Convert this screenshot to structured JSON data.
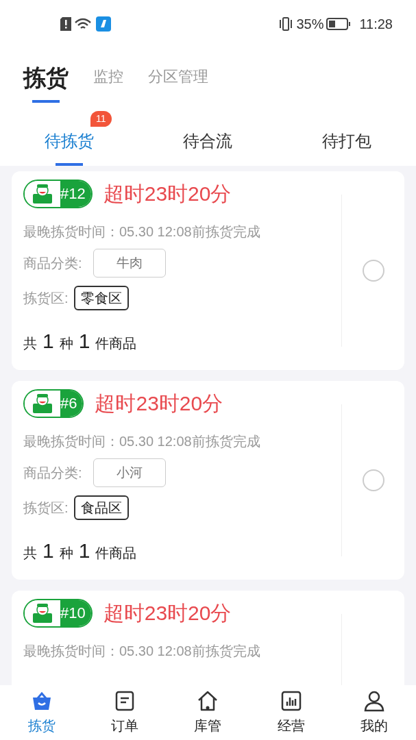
{
  "status_bar": {
    "battery": "35%",
    "time": "11:28"
  },
  "top_tabs": [
    {
      "label": "拣货",
      "selected": true
    },
    {
      "label": "监控",
      "selected": false
    },
    {
      "label": "分区管理",
      "selected": false
    }
  ],
  "sub_tabs": [
    {
      "label": "待拣货",
      "selected": true,
      "badge": "11"
    },
    {
      "label": "待合流",
      "selected": false
    },
    {
      "label": "待打包",
      "selected": false
    }
  ],
  "orders": [
    {
      "number": "#12",
      "overdue": "超时23时20分",
      "deadline": "最晚拣货时间：05.30 12:08前拣货完成",
      "category_label": "商品分类:",
      "category": "牛肉",
      "zone_label": "拣货区:",
      "zone": "零食区",
      "count": [
        "共",
        "1",
        "种",
        "1",
        "件商品"
      ],
      "selected": false
    },
    {
      "number": "#6",
      "overdue": "超时23时20分",
      "deadline": "最晚拣货时间：05.30 12:08前拣货完成",
      "category_label": "商品分类:",
      "category": "小河",
      "zone_label": "拣货区:",
      "zone": "食品区",
      "count": [
        "共",
        "1",
        "种",
        "1",
        "件商品"
      ],
      "selected": false
    },
    {
      "number": "#10",
      "overdue": "超时23时20分",
      "deadline": "最晚拣货时间：05.30 12:08前拣货完成"
    }
  ],
  "bottom_nav": [
    {
      "label": "拣货",
      "kind": "basket",
      "selected": true
    },
    {
      "label": "订单",
      "kind": "note",
      "selected": false
    },
    {
      "label": "库管",
      "kind": "home",
      "selected": false
    },
    {
      "label": "经营",
      "kind": "chart",
      "selected": false
    },
    {
      "label": "我的",
      "kind": "user",
      "selected": false
    }
  ]
}
